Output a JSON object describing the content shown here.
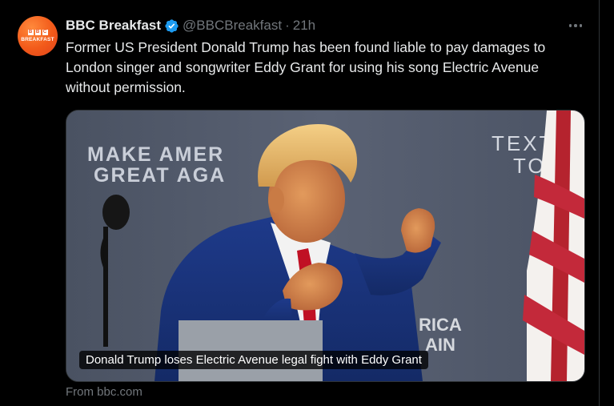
{
  "tweet": {
    "avatar": {
      "letters": [
        "B",
        "B",
        "C"
      ],
      "label": "BREAKFAST"
    },
    "author_name": "BBC Breakfast",
    "handle": "@BBCBreakfast",
    "separator": "·",
    "time": "21h",
    "text": "Former US President Donald Trump has been found liable to pay damages to London singer and songwriter Eddy Grant for using his song Electric Avenue without permission.",
    "media": {
      "backdrop_text_line1": "MAKE AMER",
      "backdrop_text_line2": "GREAT AGA",
      "backdrop_text_right1": "TEXT",
      "backdrop_text_right2": "TO 8",
      "podium_text_line1": "RICA",
      "podium_text_line2": "AIN",
      "caption": "Donald Trump loses Electric Avenue legal fight with Eddy Grant"
    },
    "source": "From bbc.com"
  },
  "icons": {
    "verified": "verified-badge-icon",
    "more": "more-options-icon"
  },
  "colors": {
    "background": "#000000",
    "text_primary": "#e7e9ea",
    "text_secondary": "#71767b",
    "verified_blue": "#1d9bf0",
    "bbc_orange": "#f25a1a"
  }
}
